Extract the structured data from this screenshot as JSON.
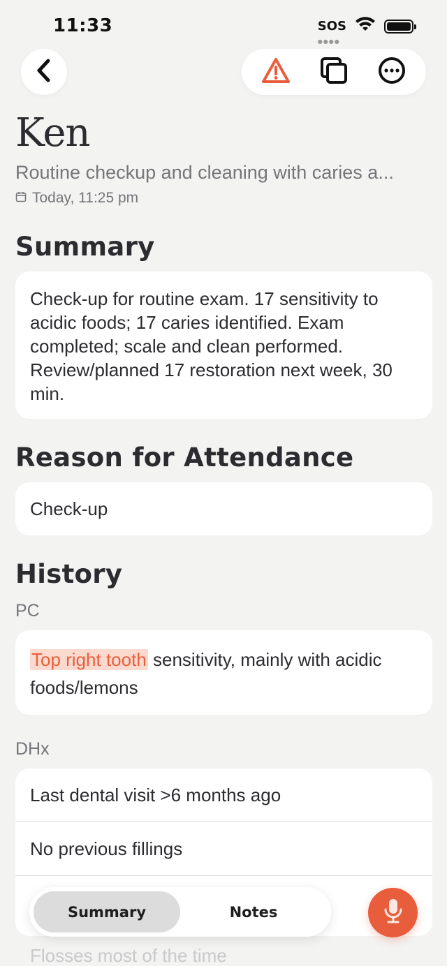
{
  "status": {
    "time": "11:33",
    "sos": "SOS"
  },
  "header": {
    "patient_name": "Ken",
    "subtitle": "Routine checkup and cleaning with caries a...",
    "date": "Today, 11:25 pm"
  },
  "summary": {
    "title": "Summary",
    "text": "Check-up for routine exam. 17 sensitivity to acidic foods; 17 caries identified. Exam completed; scale and clean performed. Review/planned 17 restoration next week, 30 min."
  },
  "attendance": {
    "title": "Reason for Attendance",
    "text": "Check-up"
  },
  "history": {
    "title": "History",
    "pc_label": "PC",
    "pc_highlight": "Top right tooth",
    "pc_text": " sensitivity, mainly with acidic foods/lemons",
    "dhx_label": "DHx",
    "dhx_items": [
      "Last dental visit >6 months ago",
      "No previous fillings"
    ],
    "faded_item": "Flosses most of the time"
  },
  "tabs": {
    "summary_label": "Summary",
    "notes_label": "Notes",
    "active": "Summary"
  },
  "colors": {
    "accent": "#e85e3d",
    "highlight_bg": "#fbd9cf"
  },
  "icons": [
    "chevron-left-icon",
    "warning-icon",
    "copy-icon",
    "more-icon",
    "microphone-icon",
    "calendar-icon",
    "wifi-icon",
    "battery-icon"
  ]
}
